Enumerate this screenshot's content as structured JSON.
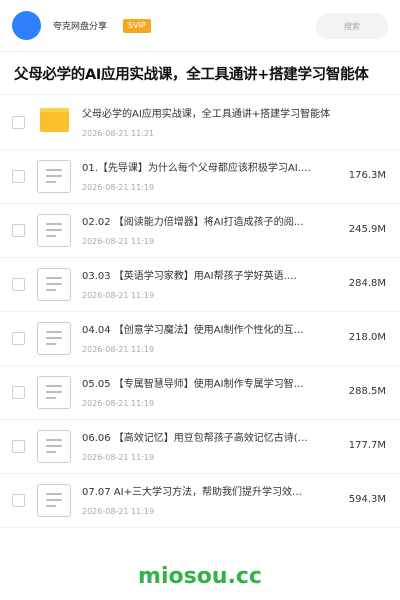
{
  "header": {
    "app_name": "夸克网盘分享",
    "badge": "SVIP",
    "search_placeholder": "搜索"
  },
  "folder": {
    "title": "父母必学的AI应用实战课，全工具通讲+搭建学习智能体"
  },
  "files": [
    {
      "name": "父母必学的AI应用实战课，全工具通讲+搭建学习智能体",
      "date": "2026-08-21 11:21",
      "size": "",
      "type": "folder"
    },
    {
      "name": "01.【先导课】为什么每个父母都应该积极学习AI.…",
      "date": "2026-08-21 11:19",
      "size": "176.3M",
      "type": "file"
    },
    {
      "name": "02.02 【阅读能力倍增器】将AI打造成孩子的阅…",
      "date": "2026-08-21 11:19",
      "size": "245.9M",
      "type": "file"
    },
    {
      "name": "03.03 【英语学习家教】用AI帮孩子学好英语.…",
      "date": "2026-08-21 11:19",
      "size": "284.8M",
      "type": "file"
    },
    {
      "name": "04.04 【创意学习魔法】使用AI制作个性化的互…",
      "date": "2026-08-21 11:19",
      "size": "218.0M",
      "type": "file"
    },
    {
      "name": "05.05 【专属智慧导师】使用AI制作专属学习智…",
      "date": "2026-08-21 11:19",
      "size": "288.5M",
      "type": "file"
    },
    {
      "name": "06.06 【高效记忆】用豆包帮孩子高效记忆古诗(…",
      "date": "2026-08-21 11:19",
      "size": "177.7M",
      "type": "file"
    },
    {
      "name": "07.07 AI+三大学习方法，帮助我们提升学习效…",
      "date": "2026-08-21 11:19",
      "size": "594.3M",
      "type": "file"
    }
  ],
  "footer": {
    "brand": "miosou.cc"
  },
  "colors": {
    "avatar": "#2f80ff",
    "badge": "#f5a623",
    "folder": "#fbc02d",
    "brand": "#33b24a"
  }
}
